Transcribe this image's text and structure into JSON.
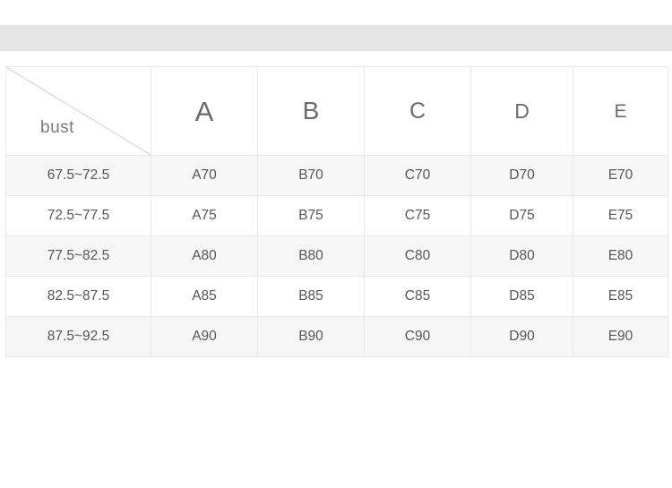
{
  "banner": {
    "present": true,
    "color": "#e4e4e4"
  },
  "table": {
    "corner_label": "bust",
    "corner_diagonal_icon": "diagonal-split-line",
    "cup_headers": [
      "A",
      "B",
      "C",
      "D",
      "E"
    ],
    "bust_ranges": [
      "67.5~72.5",
      "72.5~77.5",
      "77.5~82.5",
      "82.5~87.5",
      "87.5~92.5"
    ],
    "rows": [
      {
        "bust": "67.5~72.5",
        "sizes": [
          "A70",
          "B70",
          "C70",
          "D70",
          "E70"
        ]
      },
      {
        "bust": "72.5~77.5",
        "sizes": [
          "A75",
          "B75",
          "C75",
          "D75",
          "E75"
        ]
      },
      {
        "bust": "77.5~82.5",
        "sizes": [
          "A80",
          "B80",
          "C80",
          "D80",
          "E80"
        ]
      },
      {
        "bust": "82.5~87.5",
        "sizes": [
          "A85",
          "B85",
          "C85",
          "D85",
          "E85"
        ]
      },
      {
        "bust": "87.5~92.5",
        "sizes": [
          "A90",
          "B90",
          "C90",
          "D90",
          "E90"
        ]
      }
    ]
  },
  "colors": {
    "banner": "#e4e4e4",
    "row_stripe": "#f6f6f6",
    "row_plain": "#ffffff",
    "border": "#e8e8e8",
    "text": "#565656",
    "header_text": "#6b6b6b",
    "corner_text": "#7b7b7b"
  }
}
